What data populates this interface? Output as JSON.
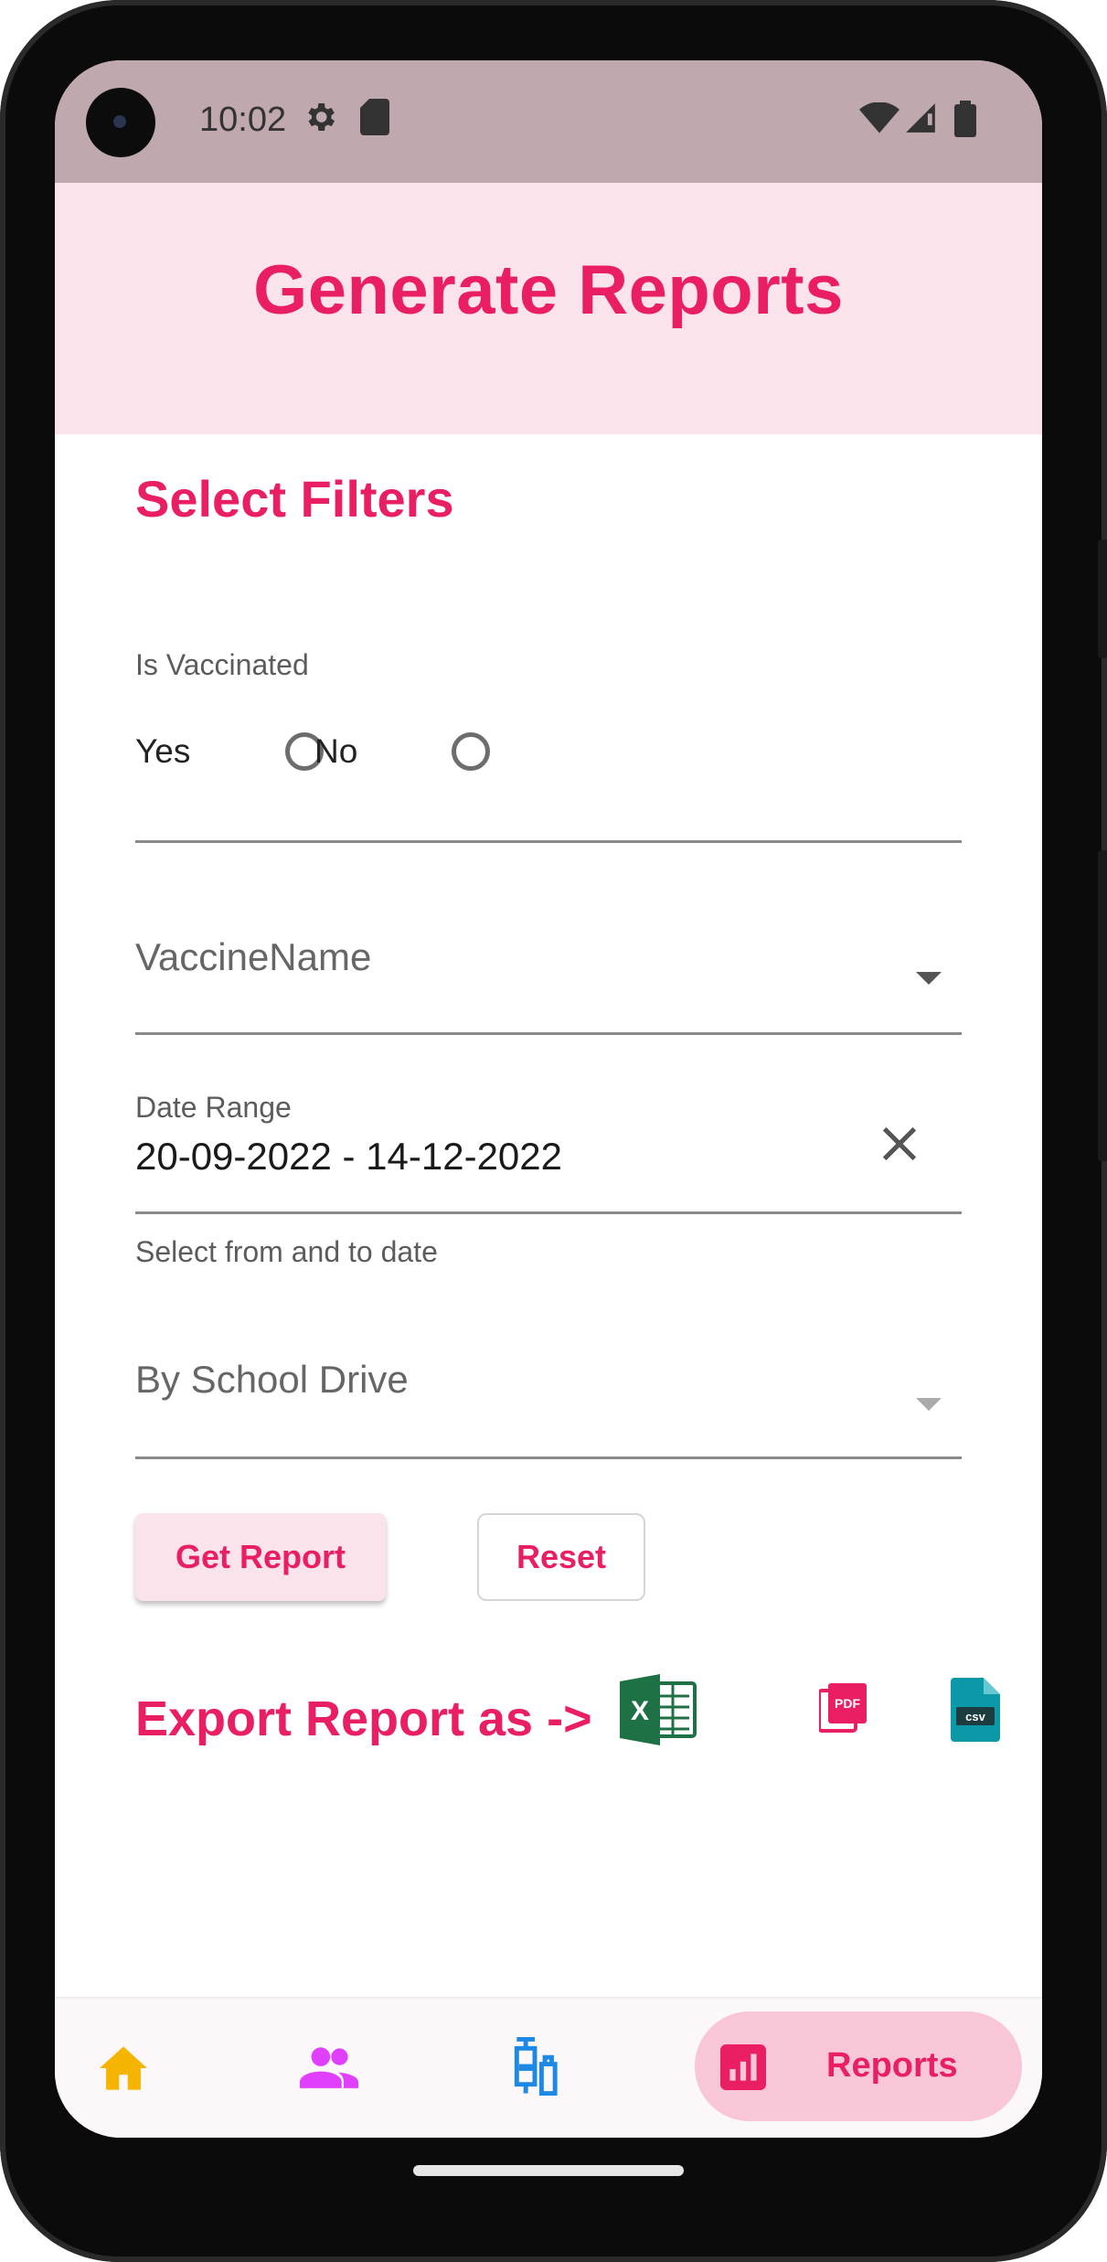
{
  "status_bar": {
    "time": "10:02"
  },
  "header": {
    "title": "Generate Reports"
  },
  "filters": {
    "section_title": "Select Filters",
    "vaccinated": {
      "label": "Is Vaccinated",
      "options": [
        "Yes",
        "No"
      ],
      "selected": null
    },
    "vaccine_name": {
      "placeholder": "VaccineName"
    },
    "date_range": {
      "label": "Date Range",
      "value": "20-09-2022 - 14-12-2022",
      "helper": "Select from and to date"
    },
    "school_drive": {
      "placeholder": "By School Drive"
    }
  },
  "actions": {
    "get_report": "Get Report",
    "reset": "Reset"
  },
  "export": {
    "label": "Export Report as ->",
    "formats": [
      "xlsx",
      "pdf",
      "csv"
    ],
    "excel_letter": "X",
    "pdf_text": "PDF",
    "csv_text": "csv"
  },
  "bottom_nav": {
    "items": [
      "home",
      "students",
      "vaccines",
      "Reports"
    ],
    "active_label": "Reports"
  },
  "colors": {
    "accent": "#e91e63",
    "header_bg": "#fae3ea",
    "status_bar_bg": "#bfa9ae",
    "home_icon": "#f5b400",
    "students_icon": "#e040fb",
    "vaccine_icon": "#1e88e5",
    "excel": "#1e7145",
    "csv": "#0b99a8"
  }
}
